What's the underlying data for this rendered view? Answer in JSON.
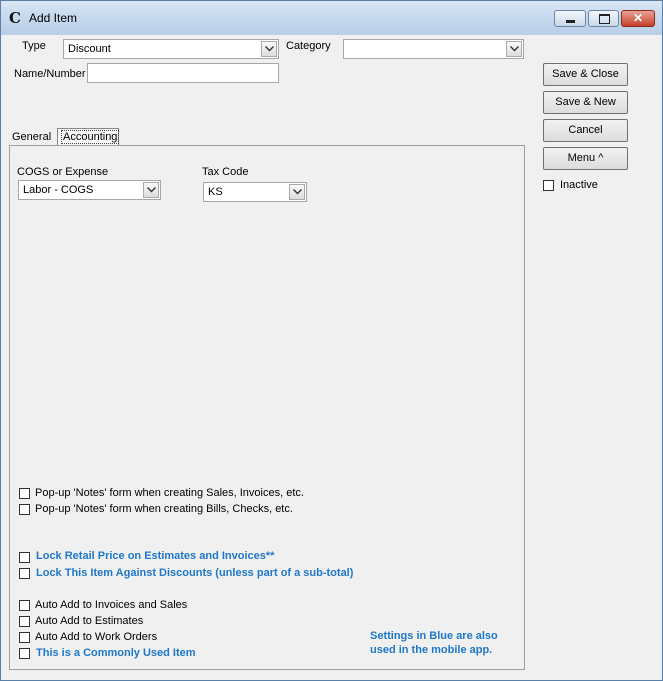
{
  "window": {
    "title": "Add Item",
    "app_icon": "C",
    "min_glyph": "_",
    "close_glyph": "✕"
  },
  "form": {
    "type_label": "Type",
    "type_value": "Discount",
    "category_label": "Category",
    "category_value": "",
    "name_label": "Name/Number",
    "name_value": ""
  },
  "buttons": {
    "save_close": "Save & Close",
    "save_new": "Save & New",
    "cancel": "Cancel",
    "menu": "Menu ^"
  },
  "inactive_label": "Inactive",
  "tabs": {
    "general": "General",
    "accounting": "Accounting"
  },
  "accounting": {
    "cogs_label": "COGS or Expense",
    "cogs_value": "Labor - COGS",
    "tax_label": "Tax Code",
    "tax_value": "KS"
  },
  "options": {
    "popup_sales": "Pop-up 'Notes' form when creating Sales, Invoices, etc.",
    "popup_bills": "Pop-up 'Notes' form when creating Bills, Checks, etc.",
    "lock_retail": "Lock Retail Price on Estimates and Invoices**",
    "lock_discounts": "Lock This Item Against Discounts (unless part of a sub-total)",
    "auto_invoices": "Auto Add to Invoices and Sales",
    "auto_estimates": "Auto Add to Estimates",
    "auto_workorders": "Auto Add to Work Orders",
    "common_item": "This is a Commonly Used Item"
  },
  "blue_note_line1": "Settings in Blue are also",
  "blue_note_line2": "used in the mobile app.",
  "colors": {
    "blue_text": "#1f78c8",
    "title_bar": "#c7d9ee",
    "close_button": "#c4402b"
  }
}
